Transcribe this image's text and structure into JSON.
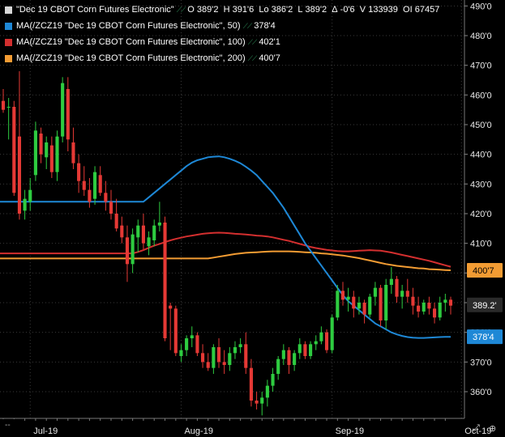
{
  "legend": {
    "main": {
      "name": "\"Dec 19 CBOT Corn Futures Electronic\"",
      "open_label": "O",
      "open": "389'2",
      "high_label": "H",
      "high": "391'6",
      "low_label": "Lo",
      "low": "386'2",
      "last_label": "L",
      "last": "389'2",
      "change_label": "Δ",
      "change": "-0'6",
      "volume_label": "V",
      "volume": "133939",
      "oi_label": "OI",
      "oi": "67457",
      "color": "#d8d8d8"
    },
    "ma50": {
      "label": "MA(/ZCZ19 \"Dec 19 CBOT Corn Futures Electronic\", 50)",
      "value": "378'4",
      "color": "#1e88d6"
    },
    "ma100": {
      "label": "MA(/ZCZ19 \"Dec 19 CBOT Corn Futures Electronic\", 100)",
      "value": "402'1",
      "color": "#d32f2f"
    },
    "ma200": {
      "label": "MA(/ZCZ19 \"Dec 19 CBOT Corn Futures Electronic\", 200)",
      "value": "400'7",
      "color": "#f39c33"
    }
  },
  "corner_label": "--",
  "colors": {
    "up": "#2ecc40",
    "down": "#e53935",
    "grid": "#3a3a3a",
    "axis_text": "#e8e8e8",
    "background": "#000000"
  },
  "chart_data": {
    "type": "candlestick",
    "y_axis": {
      "ticks": [
        "360'0",
        "370'0",
        "380'0",
        "390'0",
        "400'0",
        "410'0",
        "420'0",
        "430'0",
        "440'0",
        "450'0",
        "460'0",
        "470'0",
        "480'0",
        "490'0"
      ],
      "tick_values": [
        360,
        370,
        380,
        390,
        400,
        410,
        420,
        430,
        440,
        450,
        460,
        470,
        480,
        490
      ],
      "ylim": [
        351,
        492
      ]
    },
    "x_axis": {
      "labels": [
        {
          "text": "Jul-19",
          "index": 5
        },
        {
          "text": "Aug-19",
          "index": 33
        },
        {
          "text": "Sep-19",
          "index": 61
        },
        {
          "text": "Oct-19",
          "index": 85
        }
      ]
    },
    "grid": true,
    "price_tags": [
      {
        "series": "ma200",
        "text": "400'7",
        "value": 400.9,
        "bg": "#f39c33",
        "fg": "#000000"
      },
      {
        "series": "last",
        "text": "389.2'",
        "value": 389.25,
        "bg": "#2a2a2a",
        "fg": "#ffffff"
      },
      {
        "series": "ma50",
        "text": "378'4",
        "value": 378.5,
        "bg": "#1e88d6",
        "fg": "#ffffff"
      }
    ],
    "candles": [
      [
        458,
        462,
        454,
        455
      ],
      [
        456,
        459,
        445,
        456
      ],
      [
        456,
        458,
        426,
        427
      ],
      [
        446,
        468,
        418,
        420
      ],
      [
        421,
        428,
        418,
        425
      ],
      [
        424,
        432,
        421,
        428
      ],
      [
        433,
        451,
        431,
        448
      ],
      [
        447,
        449,
        437,
        440
      ],
      [
        439,
        446,
        435,
        444
      ],
      [
        443,
        446,
        432,
        434
      ],
      [
        434,
        448,
        431,
        446
      ],
      [
        446,
        466,
        444,
        464
      ],
      [
        462,
        466,
        441,
        445
      ],
      [
        444,
        449,
        435,
        437
      ],
      [
        437,
        440,
        427,
        431
      ],
      [
        431,
        436,
        426,
        428
      ],
      [
        428,
        432,
        422,
        424
      ],
      [
        425,
        436,
        423,
        434
      ],
      [
        433,
        436,
        426,
        427
      ],
      [
        427,
        431,
        421,
        424
      ],
      [
        424,
        428,
        418,
        420
      ],
      [
        420,
        425,
        414,
        415
      ],
      [
        416,
        419,
        410,
        412
      ],
      [
        412,
        416,
        397,
        403
      ],
      [
        403,
        415,
        400,
        413
      ],
      [
        412,
        418,
        407,
        416
      ],
      [
        416,
        420,
        408,
        410
      ],
      [
        409,
        414,
        406,
        412
      ],
      [
        411,
        418,
        409,
        416
      ],
      [
        416,
        424,
        414,
        417
      ],
      [
        417,
        419,
        377,
        378
      ],
      [
        389,
        390,
        374,
        388
      ],
      [
        388,
        389,
        372,
        373
      ],
      [
        372,
        376,
        370,
        374
      ],
      [
        374,
        379,
        372,
        378
      ],
      [
        378,
        382,
        375,
        379
      ],
      [
        379,
        380,
        372,
        373
      ],
      [
        373,
        376,
        368,
        370
      ],
      [
        370,
        373,
        367,
        368
      ],
      [
        368,
        376,
        366,
        375
      ],
      [
        375,
        378,
        368,
        370
      ],
      [
        370,
        374,
        366,
        369
      ],
      [
        369,
        375,
        367,
        373
      ],
      [
        373,
        377,
        371,
        375
      ],
      [
        375,
        378,
        373,
        376
      ],
      [
        376,
        380,
        366,
        368
      ],
      [
        368,
        371,
        355,
        357
      ],
      [
        357,
        360,
        354,
        356
      ],
      [
        356,
        360,
        352,
        358
      ],
      [
        358,
        364,
        355,
        362
      ],
      [
        362,
        368,
        360,
        366
      ],
      [
        366,
        372,
        364,
        371
      ],
      [
        371,
        376,
        369,
        374
      ],
      [
        374,
        375,
        366,
        369
      ],
      [
        369,
        374,
        367,
        373
      ],
      [
        373,
        378,
        371,
        376
      ],
      [
        376,
        377,
        371,
        372
      ],
      [
        372,
        377,
        371,
        376
      ],
      [
        376,
        379,
        374,
        377
      ],
      [
        377,
        382,
        376,
        380
      ],
      [
        380,
        381,
        373,
        374
      ],
      [
        374,
        386,
        373,
        385
      ],
      [
        385,
        396,
        384,
        394
      ],
      [
        394,
        397,
        389,
        391
      ],
      [
        391,
        395,
        387,
        392
      ],
      [
        392,
        394,
        385,
        388
      ],
      [
        388,
        392,
        386,
        390
      ],
      [
        390,
        391,
        383,
        386
      ],
      [
        386,
        393,
        385,
        392
      ],
      [
        392,
        397,
        389,
        395
      ],
      [
        395,
        396,
        382,
        384
      ],
      [
        384,
        398,
        381,
        396
      ],
      [
        396,
        402,
        393,
        398
      ],
      [
        398,
        399,
        390,
        392
      ],
      [
        392,
        396,
        388,
        394
      ],
      [
        394,
        398,
        390,
        392
      ],
      [
        392,
        395,
        386,
        389
      ],
      [
        389,
        392,
        385,
        387
      ],
      [
        387,
        391,
        386,
        390
      ],
      [
        390,
        392,
        386,
        388
      ],
      [
        388,
        390,
        383,
        385
      ],
      [
        385,
        392,
        384,
        390
      ],
      [
        390,
        393,
        387,
        391
      ],
      [
        391,
        392,
        386,
        389
      ]
    ],
    "ma50": [
      424,
      425.5,
      427,
      428.5,
      430,
      431.5,
      433,
      434.5,
      436,
      437.2,
      438,
      438.5,
      439,
      439.2,
      439.3,
      439,
      438.5,
      437.8,
      437,
      435.8,
      434.5,
      433,
      431,
      429,
      427,
      424.5,
      422,
      419,
      416,
      413,
      410,
      407.5,
      405,
      402.5,
      400,
      397.5,
      395,
      392.5,
      390.5,
      389,
      387.5,
      386,
      384.5,
      383,
      382,
      381,
      380,
      379.3,
      378.8,
      378.4,
      378.2,
      378.1,
      378.1,
      378.2,
      378.3,
      378.4,
      378.5,
      378.5
    ],
    "ma100": [
      406.6,
      407.1,
      407.7,
      408.5,
      409.2,
      409.8,
      410.4,
      411,
      411.5,
      411.9,
      412.3,
      412.6,
      412.9,
      413.2,
      413.4,
      413.5,
      413.6,
      413.5,
      413.4,
      413.2,
      413.1,
      413,
      412.8,
      412.6,
      412.5,
      412.3,
      412,
      411.6,
      411.2,
      410.8,
      410.3,
      409.8,
      409.3,
      408.8,
      408.4,
      408.1,
      407.8,
      407.6,
      407.4,
      407.3,
      407.3,
      407.4,
      407.5,
      407.6,
      407.7,
      407.6,
      407.5,
      407.2,
      406.9,
      406.5,
      406.1,
      405.7,
      405.3,
      404.9,
      404.5,
      404.1,
      403.6,
      403.1,
      402.6,
      402.1
    ],
    "ma200": [
      404.9,
      405.2,
      405.5,
      405.8,
      406.1,
      406.4,
      406.6,
      406.8,
      406.9,
      407,
      407.1,
      407.2,
      407.3,
      407.3,
      407.3,
      407.3,
      407.2,
      407.1,
      407,
      406.9,
      406.8,
      406.6,
      406.5,
      406.3,
      406.1,
      405.9,
      405.6,
      405.3,
      405,
      404.6,
      404.2,
      403.8,
      403.4,
      403,
      402.7,
      402.4,
      402.2,
      402,
      401.8,
      401.6,
      401.5,
      401.3,
      401.2,
      401.1,
      401,
      400.9
    ]
  }
}
